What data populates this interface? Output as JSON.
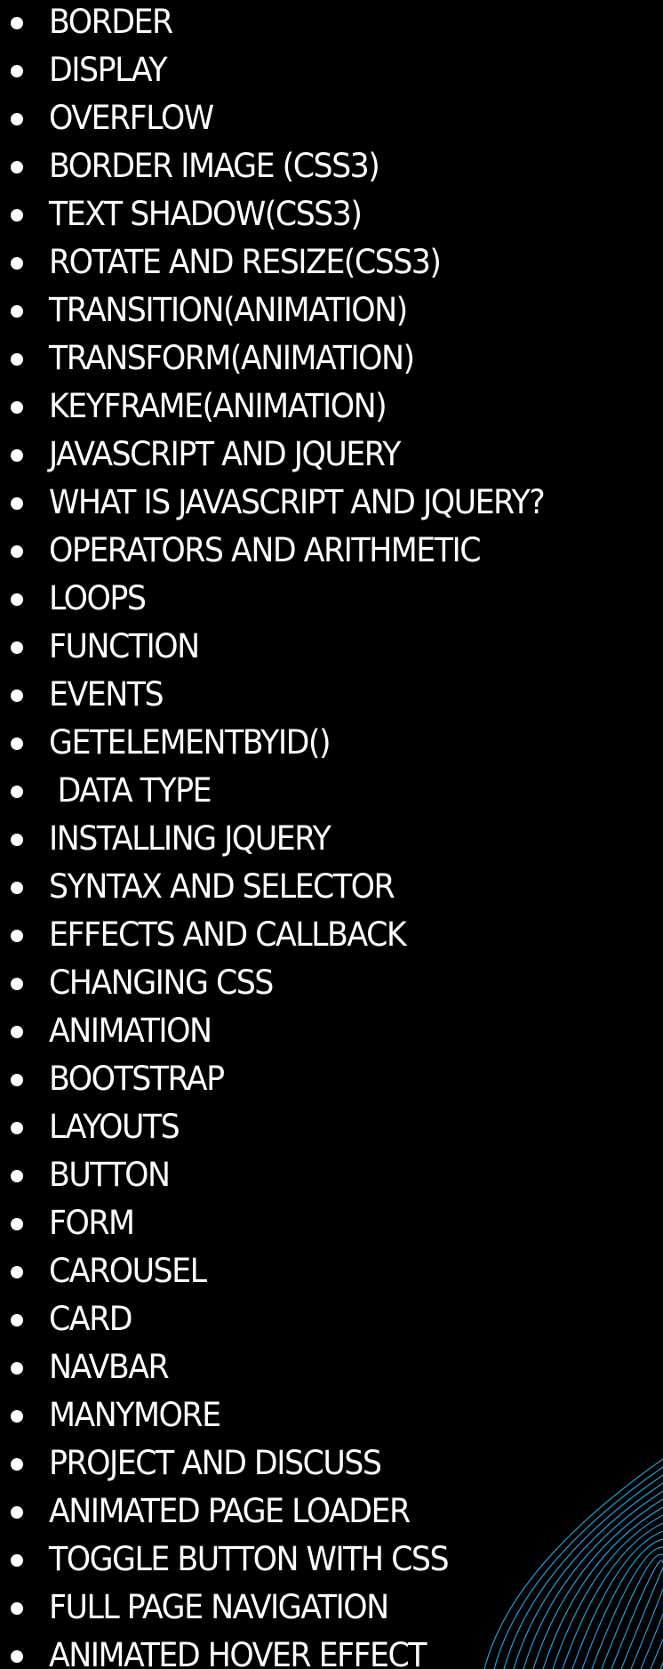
{
  "colors": {
    "background": "#000000",
    "text": "#ffffff",
    "accent_lines": "#1ea0d8"
  },
  "topics": [
    "BORDER",
    "DISPLAY",
    "OVERFLOW",
    "BORDER IMAGE (CSS3)",
    "TEXT SHADOW(CSS3)",
    "ROTATE AND RESIZE(CSS3)",
    "TRANSITION(ANIMATION)",
    "TRANSFORM(ANIMATION)",
    "KEYFRAME(ANIMATION)",
    "JAVASCRIPT AND JQUERY",
    "WHAT IS JAVASCRIPT AND JQUERY?",
    "OPERATORS AND ARITHMETIC",
    "LOOPS",
    "FUNCTION",
    "EVENTS",
    "GETELEMENTBYID()",
    " DATA TYPE",
    "INSTALLING JQUERY",
    "SYNTAX AND SELECTOR",
    "EFFECTS AND CALLBACK",
    "CHANGING CSS",
    "ANIMATION",
    "BOOTSTRAP",
    "LAYOUTS",
    "BUTTON",
    "FORM",
    "CAROUSEL",
    "CARD",
    "NAVBAR",
    "MANYMORE",
    "PROJECT AND DISCUSS",
    "ANIMATED PAGE LOADER",
    "TOGGLE BUTTON WITH CSS",
    "FULL PAGE NAVIGATION",
    "ANIMATED HOVER EFFECT"
  ]
}
